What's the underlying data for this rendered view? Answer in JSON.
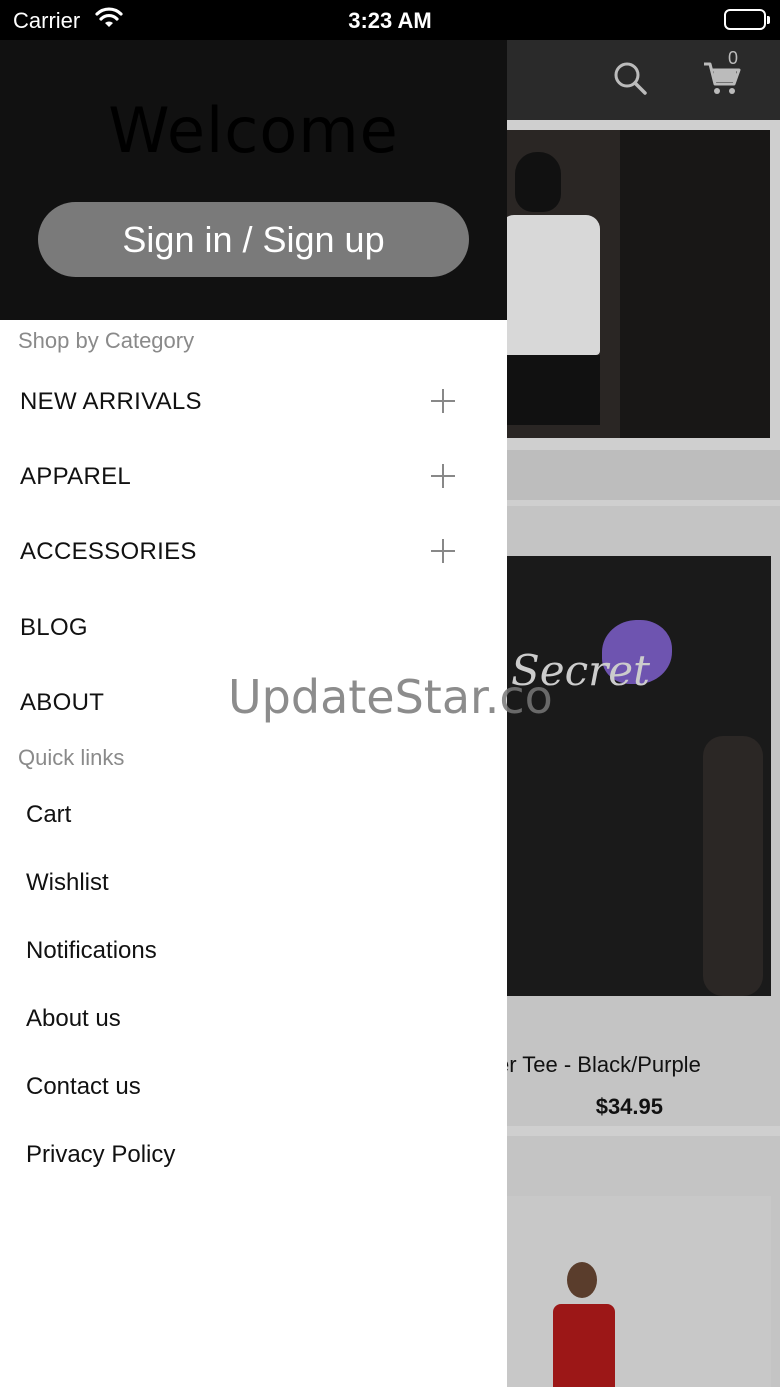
{
  "status_bar": {
    "carrier": "Carrier",
    "time": "3:23 AM",
    "icons": [
      "wifi-icon",
      "battery-icon"
    ]
  },
  "app": {
    "cart_count": "0",
    "icons": [
      "search-icon",
      "cart-icon"
    ],
    "product": {
      "title": "er Tee - Black/Purple",
      "price": "$34.95"
    }
  },
  "drawer": {
    "welcome": "Welcome",
    "signin_label": "Sign in / Sign up",
    "shop_by_category_label": "Shop by Category",
    "categories": [
      {
        "label": "NEW ARRIVALS",
        "expandable": true
      },
      {
        "label": "APPAREL",
        "expandable": true
      },
      {
        "label": "ACCESSORIES",
        "expandable": true
      },
      {
        "label": "BLOG",
        "expandable": false
      },
      {
        "label": "ABOUT",
        "expandable": false
      }
    ],
    "quick_links_label": "Quick links",
    "quick_links": [
      {
        "label": "Cart"
      },
      {
        "label": "Wishlist"
      },
      {
        "label": "Notifications"
      },
      {
        "label": "About us"
      },
      {
        "label": "Contact us"
      },
      {
        "label": "Privacy Policy"
      }
    ]
  },
  "watermark": "UpdateStar.co",
  "colors": {
    "drawer_header_bg": "#111111",
    "signin_button_bg": "#7a7a7a",
    "section_label": "#8a8a8a"
  }
}
